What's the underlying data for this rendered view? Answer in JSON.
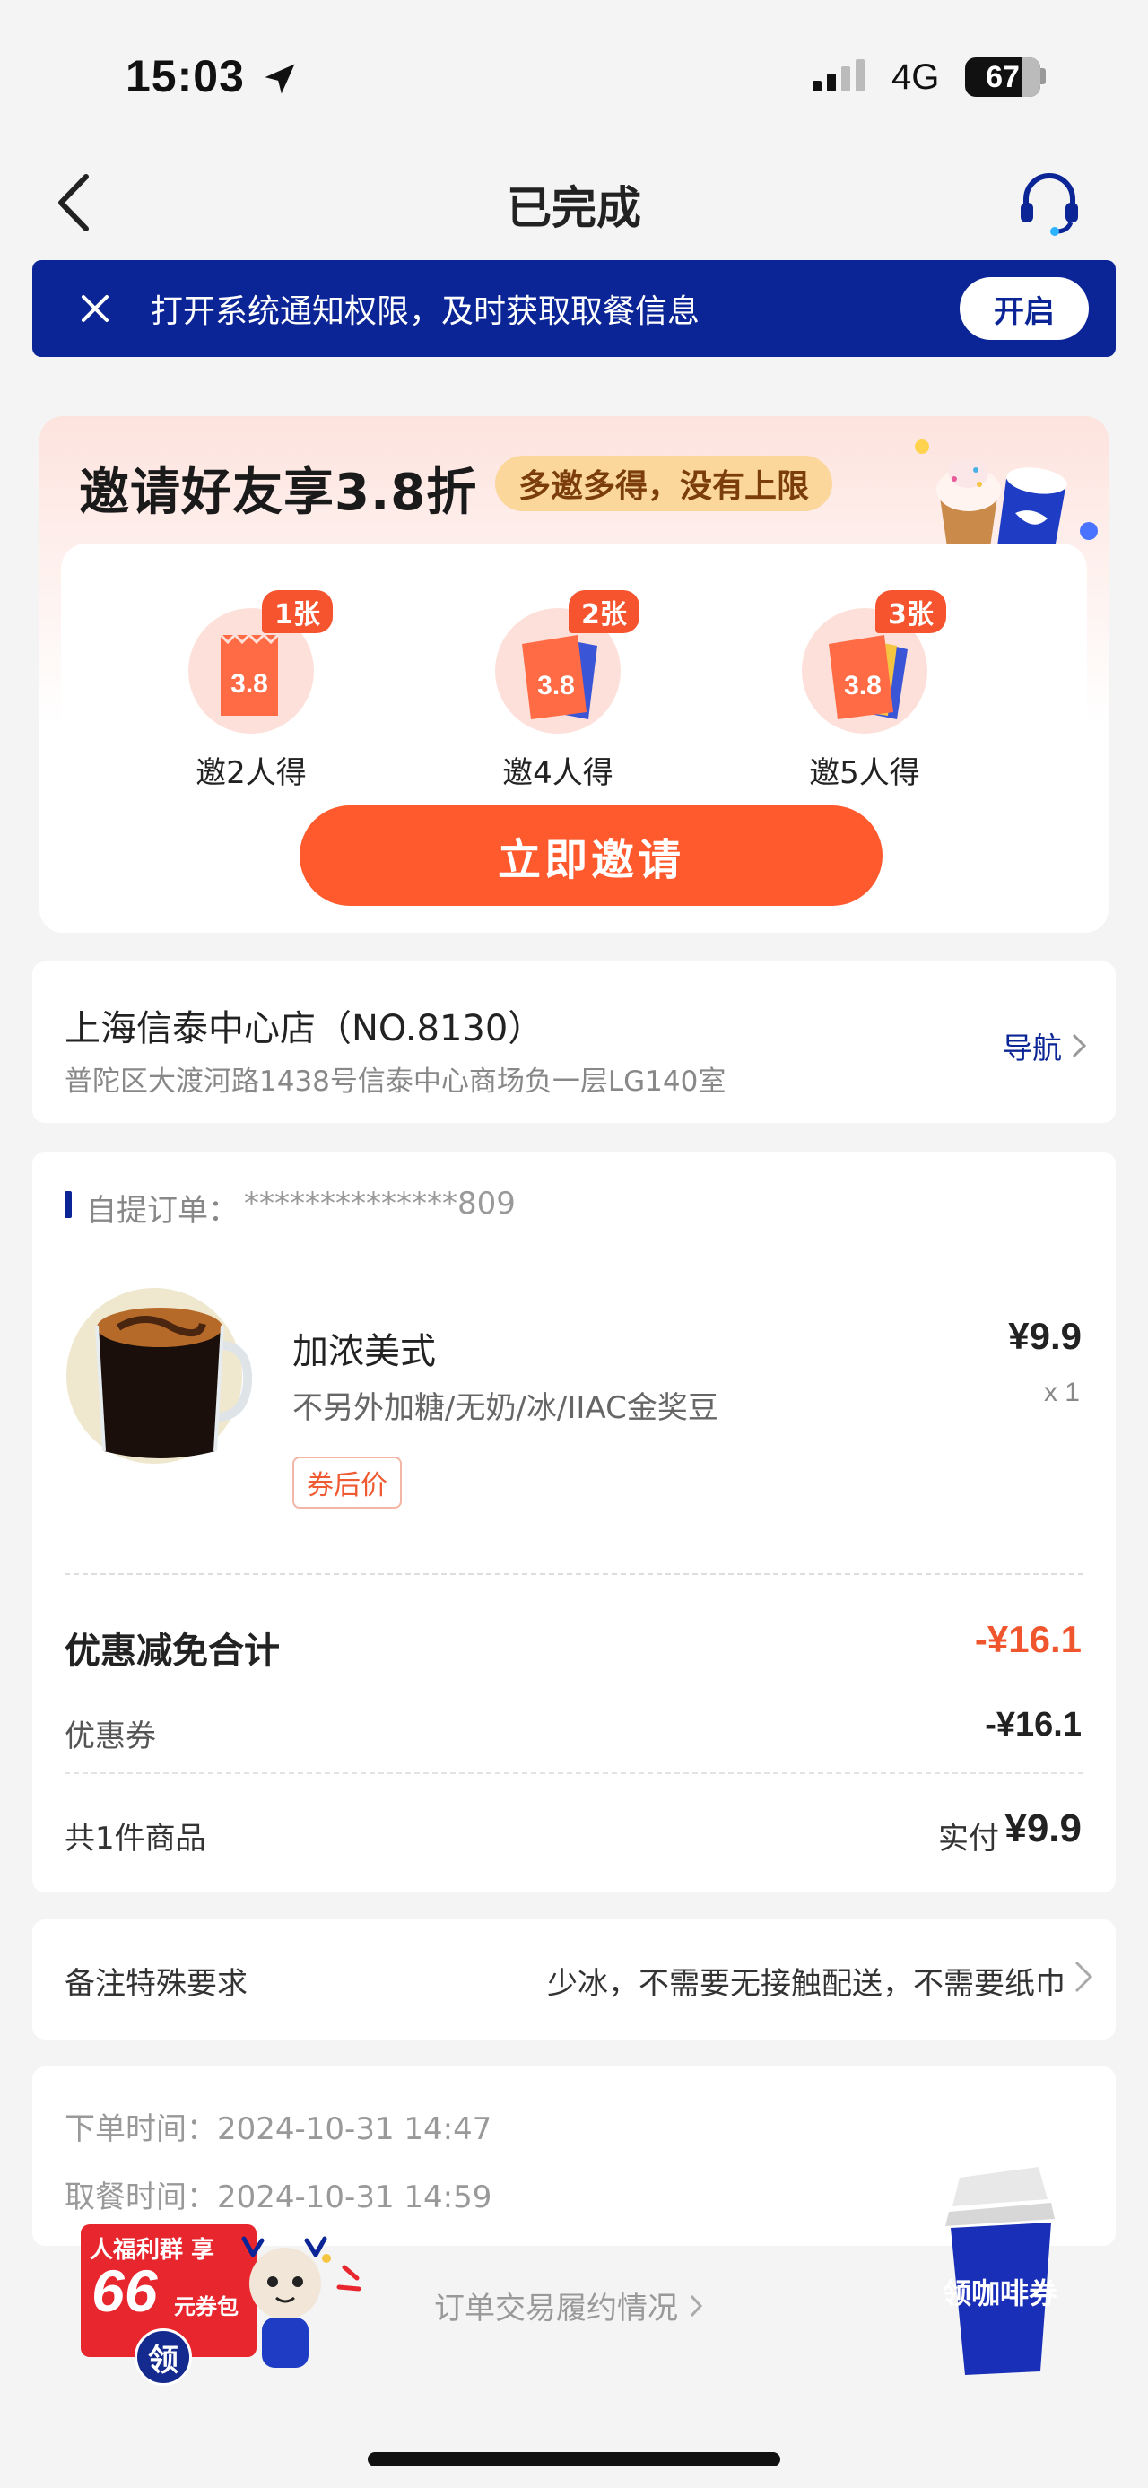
{
  "status_bar": {
    "time": "15:03",
    "network": "4G",
    "battery": "67"
  },
  "nav": {
    "title": "已完成"
  },
  "notice": {
    "text": "打开系统通知权限，及时获取取餐信息",
    "button": "开启"
  },
  "invite": {
    "title": "邀请好友享3.8折",
    "tag": "多邀多得，没有上限",
    "rewards": [
      {
        "badge": "1张",
        "label": "邀2人得",
        "ticket_text": "3.8"
      },
      {
        "badge": "2张",
        "label": "邀4人得",
        "ticket_text": "3.8"
      },
      {
        "badge": "3张",
        "label": "邀5人得",
        "ticket_text": "3.8"
      }
    ],
    "button": "立即邀请"
  },
  "store": {
    "name": "上海信泰中心店（NO.8130）",
    "address": "普陀区大渡河路1438号信泰中心商场负一层LG140室",
    "nav_label": "导航"
  },
  "order": {
    "number_label": "自提订单：",
    "number": "**************809",
    "item": {
      "name": "加浓美式",
      "spec": "不另外加糖/无奶/冰/IIAC金奖豆",
      "tag": "券后价",
      "price": "¥9.9",
      "qty": "x 1"
    },
    "discount_label": "优惠减免合计",
    "discount_value": "-¥16.1",
    "coupon_label": "优惠券",
    "coupon_value": "-¥16.1",
    "count_label": "共1件商品",
    "paid_label": "实付",
    "paid_value": "¥9.9"
  },
  "remark": {
    "label": "备注特殊要求",
    "value": "少冰，不需要无接触配送，不需要纸巾"
  },
  "times": {
    "order_label": "下单时间：",
    "order_value": "2024-10-31 14:47",
    "pickup_label": "取餐时间：",
    "pickup_value": "2024-10-31 14:59"
  },
  "bottom": {
    "link": "订单交易履约情况",
    "promo_left": {
      "top": "人福利群 享",
      "amount": "66",
      "unit": "元券包",
      "get": "领"
    },
    "promo_right": {
      "text": "领咖啡券"
    }
  },
  "colors": {
    "brand_blue": "#0c2596",
    "accent_orange": "#ff5a2e",
    "discount_red": "#f0562d"
  }
}
